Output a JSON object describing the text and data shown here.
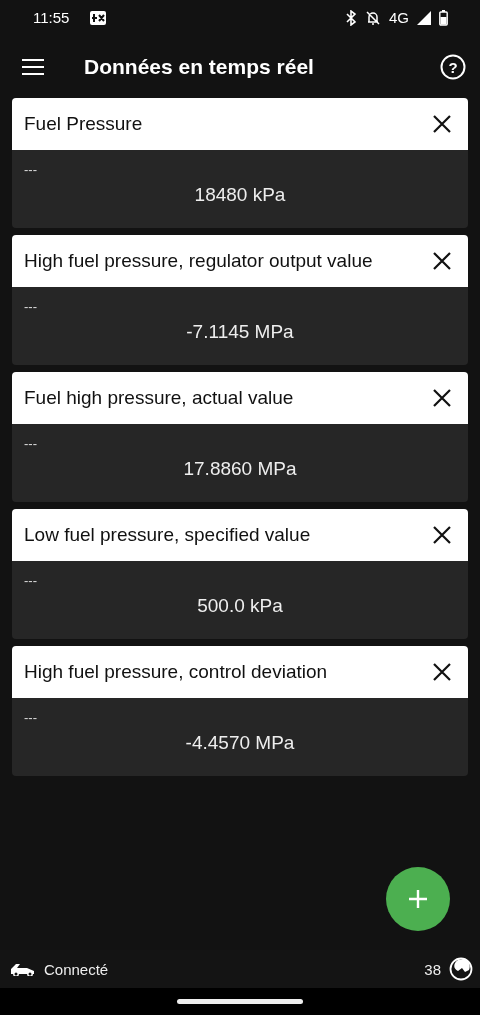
{
  "status_bar": {
    "time": "11:55",
    "network": "4G"
  },
  "app_bar": {
    "title": "Données en temps réel",
    "help_glyph": "?"
  },
  "cards": [
    {
      "title": "Fuel Pressure",
      "label": "---",
      "value": "18480 kPa"
    },
    {
      "title": "High fuel pressure, regulator output value",
      "label": "---",
      "value": "-7.1145 MPa"
    },
    {
      "title": "Fuel high pressure, actual value",
      "label": "---",
      "value": "17.8860 MPa"
    },
    {
      "title": "Low fuel pressure, specified value",
      "label": "---",
      "value": "500.0 kPa"
    },
    {
      "title": "High fuel pressure, control deviation",
      "label": "---",
      "value": "-4.4570 MPa"
    }
  ],
  "footer": {
    "status": "Connecté",
    "count": "38"
  }
}
